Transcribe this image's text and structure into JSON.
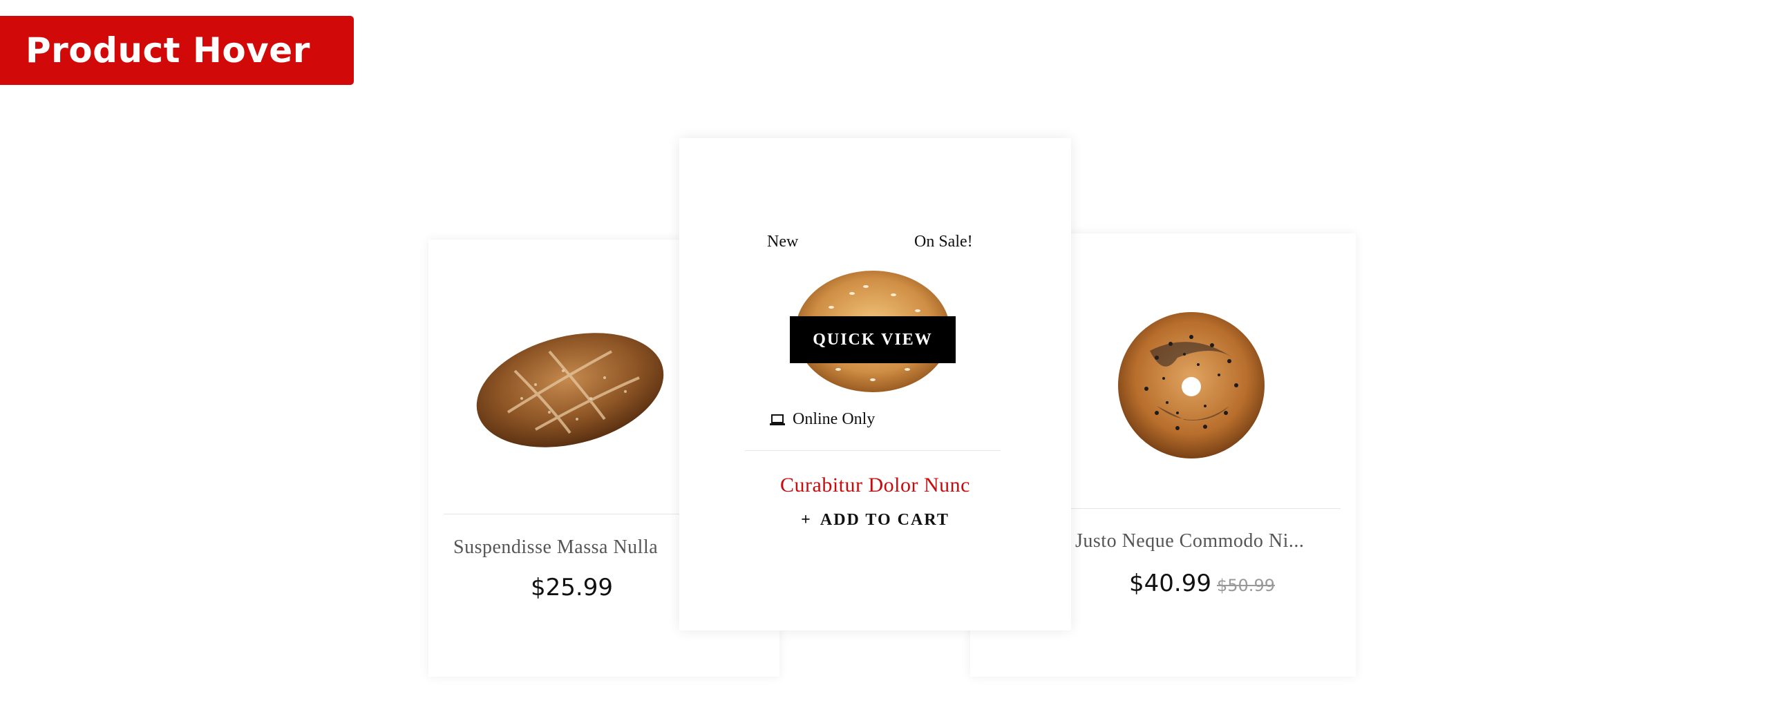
{
  "header": {
    "title": "Product Hover"
  },
  "products": [
    {
      "name": "Suspendisse Massa Nulla",
      "price": "$25.99",
      "image_icon": "bread-loaf-image"
    },
    {
      "name": "Curabitur Dolor Nunc",
      "badge_new": "New",
      "badge_sale": "On Sale!",
      "quick_view": "QUICK VIEW",
      "online_only": "Online Only",
      "add_to_cart": "ADD TO CART",
      "add_icon": "+",
      "image_icon": "sesame-bagel-image"
    },
    {
      "name": "Justo Neque Commodo Ni...",
      "price": "$40.99",
      "old_price": "$50.99",
      "image_icon": "poppy-seed-bagel-image"
    }
  ],
  "colors": {
    "brand_red": "#d20909",
    "product_name_hover": "#c80c0c",
    "button_black": "#000000"
  }
}
